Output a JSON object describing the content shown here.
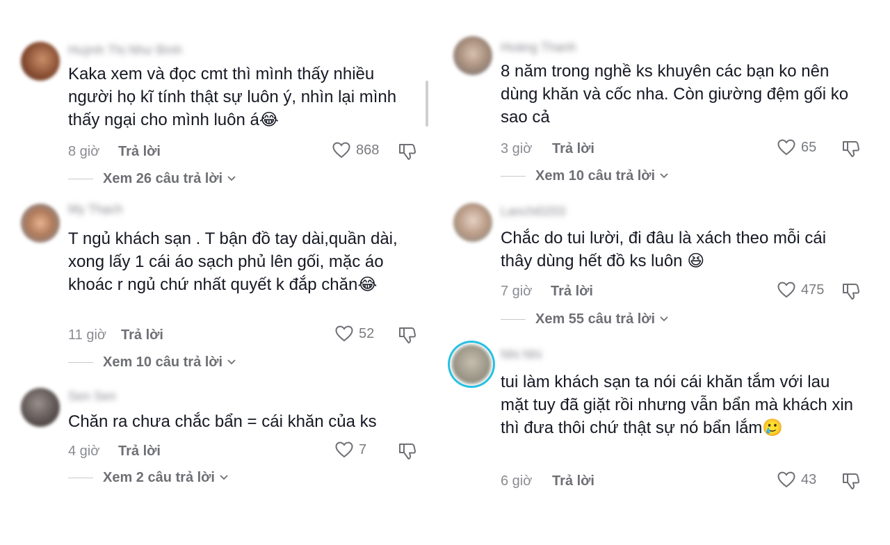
{
  "comments": [
    {
      "username": "Huỳnh Thị Như Bình",
      "text": "Kaka xem và đọc cmt thì mình thấy nhiều người họ kĩ tính thật sự luôn ý, nhìn lại mình thấy ngại cho mình luôn á😂",
      "time": "8 giờ",
      "reply_label": "Trả lời",
      "likes": "868",
      "view_replies": "Xem 26 câu trả lời"
    },
    {
      "username": "My Thạch",
      "text": "T ngủ khách sạn . T bận đồ tay dài,quần dài, xong lấy 1 cái áo sạch phủ lên gối, mặc áo khoác r ngủ chứ nhất quyết k đắp chăn😂",
      "time": "11 giờ",
      "reply_label": "Trả lời",
      "likes": "52",
      "view_replies": "Xem 10 câu trả lời"
    },
    {
      "username": "Sen Sen",
      "text": "Chăn ra chưa chắc bẩn = cái khăn của ks",
      "time": "4 giờ",
      "reply_label": "Trả lời",
      "likes": "7",
      "view_replies": "Xem 2 câu trả lời"
    },
    {
      "username": "Hoàng Thanh",
      "text": "8 năm trong nghề ks khuyên các bạn ko nên dùng khăn và cốc nha. Còn giường đệm gối ko sao cả",
      "time": "3 giờ",
      "reply_label": "Trả lời",
      "likes": "65",
      "view_replies": "Xem 10 câu trả lời"
    },
    {
      "username": "Lanchi0203",
      "text": "Chắc do tui lười, đi đâu là xách theo mỗi cái thây dùng hết đồ ks luôn 😆",
      "time": "7 giờ",
      "reply_label": "Trả lời",
      "likes": "475",
      "view_replies": "Xem 55 câu trả lời"
    },
    {
      "username": "Nhi Nhi",
      "text": "tui làm khách sạn ta nói cái khăn tắm với lau mặt tuy đã giặt rồi nhưng vẫn bẩn mà khách xin thì đưa thôi chứ thật sự nó bẩn lắm🥲",
      "time": "6 giờ",
      "reply_label": "Trả lời",
      "likes": "43"
    }
  ],
  "colors": {
    "text": "#161823",
    "muted": "#8a8b91",
    "story_ring": "#22c3e6"
  },
  "icons": {
    "like": "heart-outline-icon",
    "dislike": "thumbs-down-outline-icon",
    "expand": "chevron-down-icon"
  }
}
